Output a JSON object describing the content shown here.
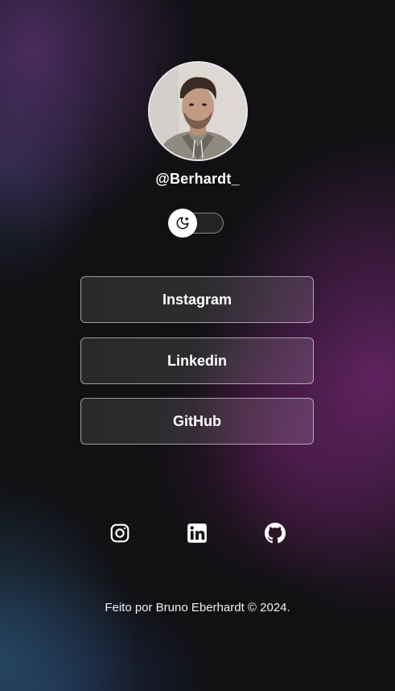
{
  "profile": {
    "username": "@Berhardt_"
  },
  "theme_toggle": {
    "state": "dark",
    "icon": "moon-stars-icon"
  },
  "links": [
    {
      "label": "Instagram"
    },
    {
      "label": "Linkedin"
    },
    {
      "label": "GitHub"
    }
  ],
  "social_icons": [
    "instagram-icon",
    "linkedin-icon",
    "github-icon"
  ],
  "footer": {
    "text": "Feito por Bruno Eberhardt © 2024."
  },
  "colors": {
    "background": "#111114",
    "glow_purple": "#7a2878",
    "glow_blue": "#28506e",
    "text": "#ffffff"
  }
}
